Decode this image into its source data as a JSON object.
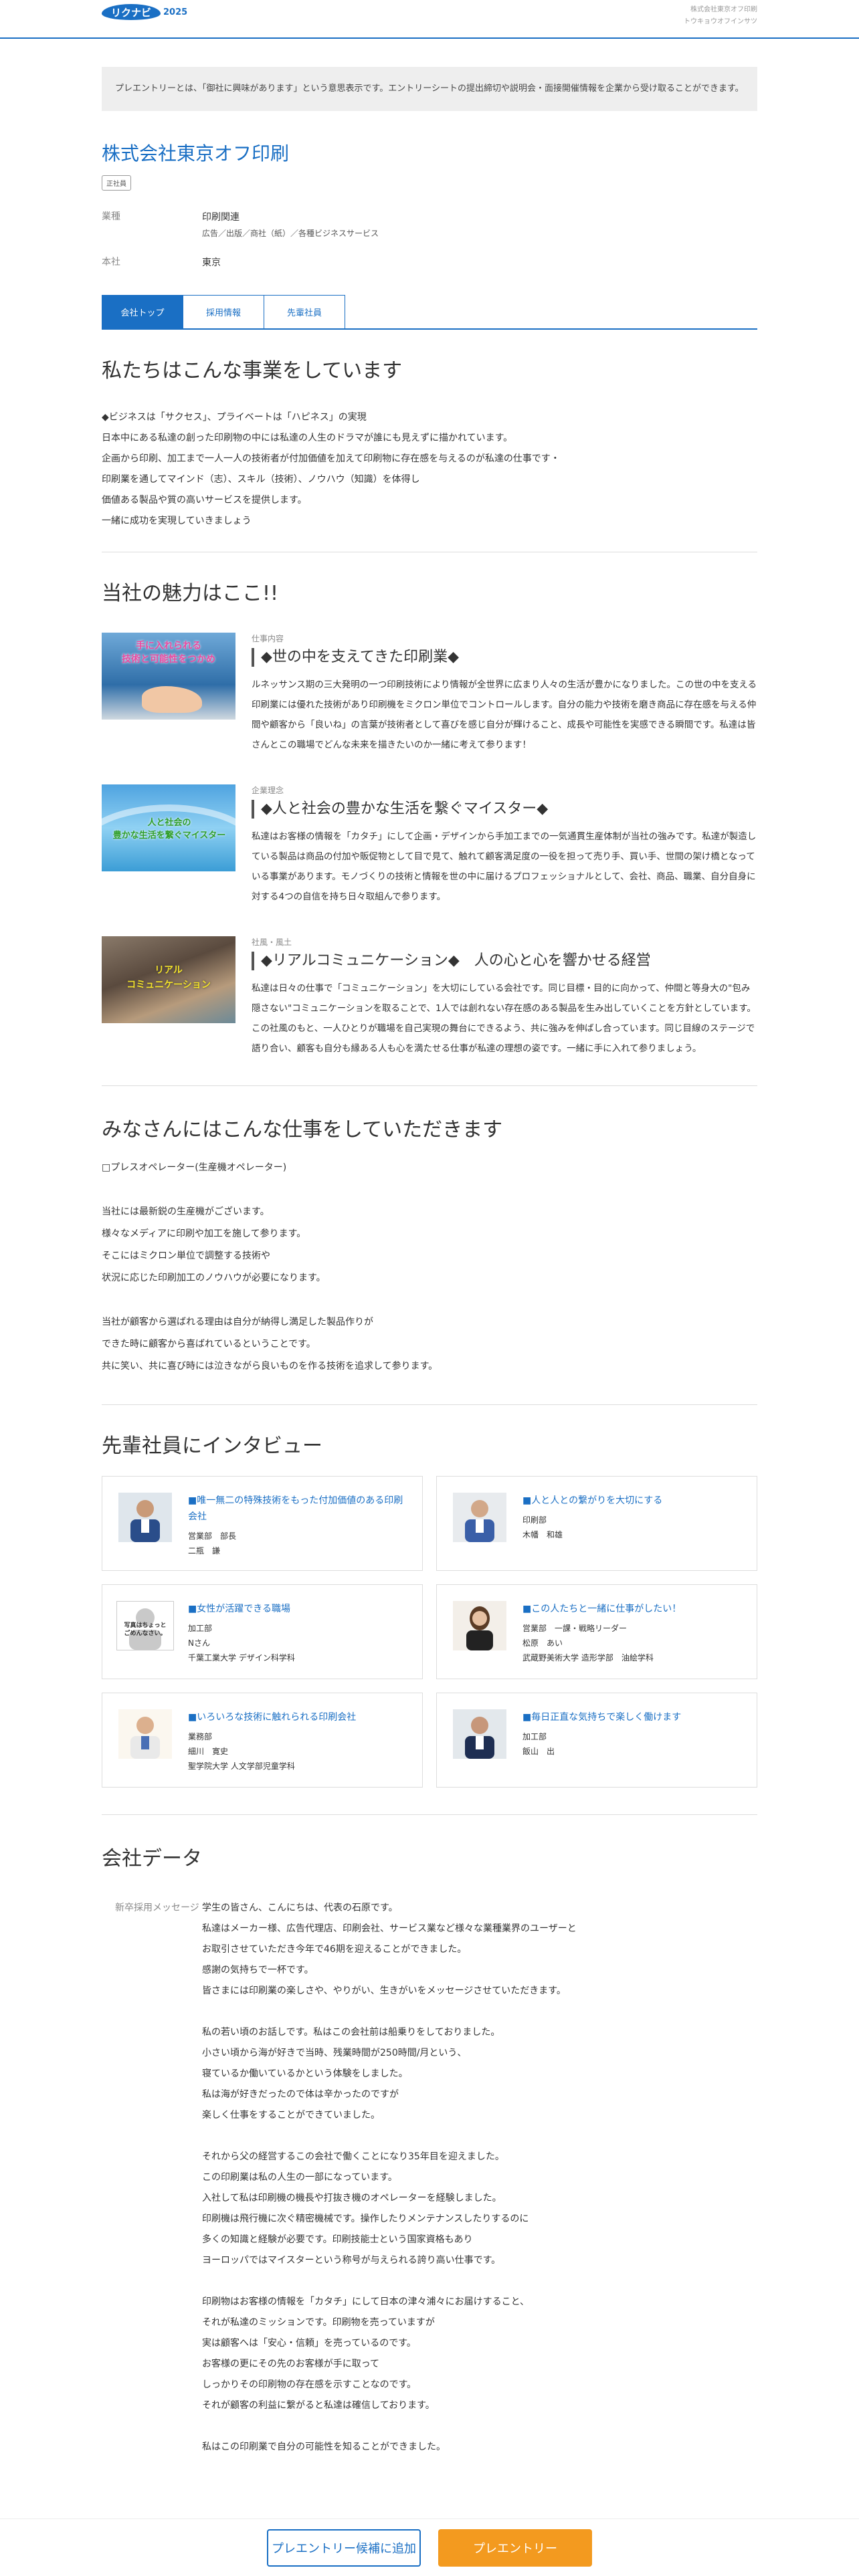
{
  "header": {
    "logo": "リクナビ",
    "logo_year": "2025",
    "company_sub": "株式会社東京オフ印刷",
    "company_sub_kana": "トウキョウオフインサツ"
  },
  "notice": "プレエントリーとは、「御社に興味があります」という意思表示です。エントリーシートの提出締切や説明会・面接開催情報を企業から受け取ることができます。",
  "company": {
    "name": "株式会社東京オフ印刷",
    "badge": "正社員",
    "industry_label": "業種",
    "industry": "印刷関連",
    "industry_sub": "広告／出版／商社（紙）／各種ビジネスサービス",
    "hq_label": "本社",
    "hq": "東京"
  },
  "tabs": [
    {
      "label": "会社トップ",
      "active": true
    },
    {
      "label": "採用情報",
      "active": false
    },
    {
      "label": "先輩社員",
      "active": false
    }
  ],
  "business": {
    "title": "私たちはこんな事業をしています",
    "text": "◆ビジネスは「サクセス」、プライベートは「ハピネス」の実現\n日本中にある私達の創った印刷物の中には私達の人生のドラマが誰にも見えずに描かれています。\n企画から印刷、加工まで一人一人の技術者が付加価値を加えて印刷物に存在感を与えるのが私達の仕事です・\n印刷業を通してマインド（志）、スキル（技術）、ノウハウ（知識）を体得し\n価値ある製品や質の高いサービスを提供します。\n一緒に成功を実現していきましょう"
  },
  "charm": {
    "title": "当社の魅力はここ!!",
    "items": [
      {
        "category": "仕事内容",
        "heading": "◆世の中を支えてきた印刷業◆",
        "image_text": "手に入れられる\n技術と可能性をつかめ",
        "text": "ルネッサンス期の三大発明の一つ印刷技術により情報が全世界に広まり人々の生活が豊かになりました。この世の中を支える印刷業には優れた技術があり印刷機をミクロン単位でコントロールします。自分の能力や技術を磨き商品に存在感を与える仲間や顧客から「良いね」の言葉が技術者として喜びを感じ自分が輝けること、成長や可能性を実感できる瞬間です。私達は皆さんとこの職場でどんな未来を描きたいのか一緒に考えて参ります！"
      },
      {
        "category": "企業理念",
        "heading": "◆人と社会の豊かな生活を繋ぐマイスター◆",
        "image_text": "人と社会の\n豊かな生活を繋ぐマイスター",
        "text": "私達はお客様の情報を「カタチ」にして企画・デザインから手加工までの一気通貫生産体制が当社の強みです。私達が製造している製品は商品の付加や販促物として目で見て、触れて顧客満足度の一役を担って売り手、買い手、世間の架け橋となっている事業があります。モノづくりの技術と情報を世の中に届けるプロフェッショナルとして、会社、商品、職業、自分自身に対する4つの自信を持ち日々取組んで参ります。"
      },
      {
        "category": "社風・風土",
        "heading": "◆リアルコミュニケーション◆　人の心と心を響かせる経営",
        "image_text": "リアル\nコミュニケーション",
        "text": "私達は日々の仕事で「コミュニケーション」を大切にしている会社です。同じ目標・目的に向かって、仲間と等身大の\"包み隠さない\"コミュニケーションを取ることで、1人では創れない存在感のある製品を生み出していくことを方針としています。この社風のもと、一人ひとりが職場を自己実現の舞台にできるよう、共に強みを伸ばし合っています。同じ目線のステージで語り合い、顧客も自分も縁ある人も心を満たせる仕事が私達の理想の姿です。一緒に手に入れて参りましょう。"
      }
    ]
  },
  "work": {
    "title": "みなさんにはこんな仕事をしていただきます",
    "text": "□プレスオペレーター(生産機オペレーター)\n\n当社には最新鋭の生産機がございます。\n様々なメディアに印刷や加工を施して参ります。\nそこにはミクロン単位で調整する技術や\n状況に応じた印刷加工のノウハウが必要になります。\n\n当社が顧客から選ばれる理由は自分が納得し満足した製品作りが\nできた時に顧客から喜ばれているということです。\n共に笑い、共に喜び時には泣きながら良いものを作る技術を追求して参ります。"
  },
  "interview": {
    "title": "先輩社員にインタビュー",
    "cards": [
      {
        "title": "■唯一無二の特殊技術をもった付加価値のある印刷会社",
        "dept": "営業部　部長",
        "name": "二瓶　謙",
        "school": ""
      },
      {
        "title": "■人と人との繋がりを大切にする",
        "dept": "印刷部",
        "name": "木幡　和雄",
        "school": ""
      },
      {
        "title": "■女性が活躍できる職場",
        "dept": "加工部",
        "name": "Nさん",
        "school": "千葉工業大学 デザイン科学科",
        "placeholder": "写真はちょっと\nごめんなさい。"
      },
      {
        "title": "■この人たちと一緒に仕事がしたい！",
        "dept": "営業部　一課・戦略リーダー",
        "name": "松原　あい",
        "school": "武蔵野美術大学 造形学部　油絵学科"
      },
      {
        "title": "■いろいろな技術に触れられる印刷会社",
        "dept": "業務部",
        "name": "細川　寛史",
        "school": "聖学院大学 人文学部児童学科"
      },
      {
        "title": "■毎日正直な気持ちで楽しく働けます",
        "dept": "加工部",
        "name": "飯山　出",
        "school": ""
      }
    ]
  },
  "company_data": {
    "title": "会社データ",
    "message_label": "新卒採用メッセージ",
    "message": "学生の皆さん、こんにちは、代表の石原です。\n私達はメーカー様、広告代理店、印刷会社、サービス業など様々な業種業界のユーザーと\nお取引させていただき今年で46期を迎えることができました。\n感謝の気持ちで一杯です。\n皆さまには印刷業の楽しさや、やりがい、生きがいをメッセージさせていただきます。\n\n私の若い頃のお話しです。私はこの会社前は船乗りをしておりました。\n小さい頃から海が好きで当時、残業時間が250時間/月という、\n寝ているか働いているかという体験をしました。\n私は海が好きだったので体は辛かったのですが\n楽しく仕事をすることができていました。\n\nそれから父の経営するこの会社で働くことになり35年目を迎えました。\nこの印刷業は私の人生の一部になっています。\n入社して私は印刷機の機長や打抜き機のオペレーターを経験しました。\n印刷機は飛行機に次ぐ精密機械です。操作したりメンテナンスしたりするのに\n多くの知識と経験が必要です。印刷技能士という国家資格もあり\nヨーロッパではマイスターという称号が与えられる誇り高い仕事です。\n\n印刷物はお客様の情報を「カタチ」にして日本の津々浦々にお届けすること、\nそれが私達のミッションです。印刷物を売っていますが\n実は顧客へは「安心・信頼」を売っているのです。\nお客様の更にその先のお客様が手に取って\nしっかりその印刷物の存在感を示すことなのです。\nそれが顧客の利益に繋がると私達は確信しております。\n\n私はこの印刷業で自分の可能性を知ることができました。"
  },
  "actions": {
    "add_candidate": "プレエントリー候補に追加",
    "pre_entry": "プレエントリー"
  },
  "colors": {
    "brand": "#1a6fc4",
    "accent": "#f39a1f"
  }
}
